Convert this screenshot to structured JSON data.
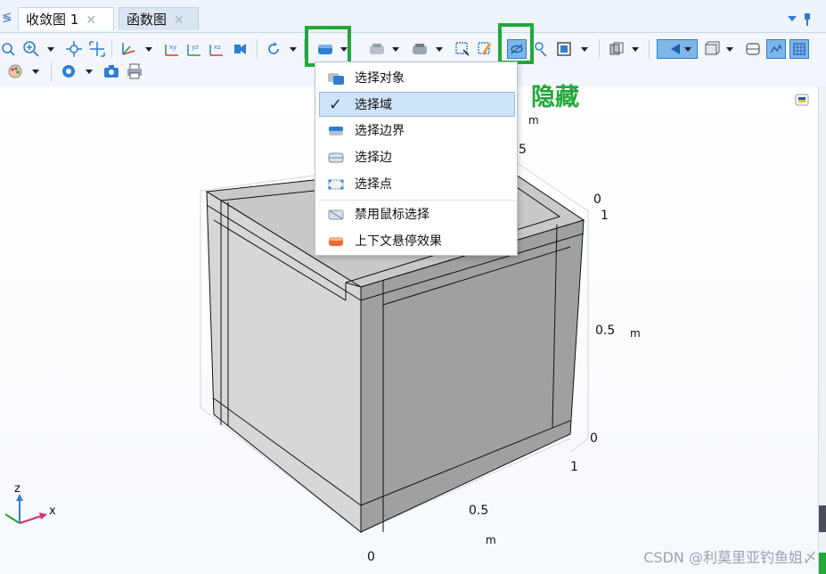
{
  "tabs": [
    {
      "label": "收敛图 1"
    },
    {
      "label": "函数图"
    }
  ],
  "selection_menu": {
    "items": [
      {
        "label": "选择对象",
        "checked": false,
        "icon": "select-object-icon"
      },
      {
        "label": "选择域",
        "checked": true,
        "icon": "checkmark-icon"
      },
      {
        "label": "选择边界",
        "checked": false,
        "icon": "select-boundary-icon"
      },
      {
        "label": "选择边",
        "checked": false,
        "icon": "select-edge-icon"
      },
      {
        "label": "选择点",
        "checked": false,
        "icon": "select-point-icon"
      }
    ],
    "items2": [
      {
        "label": "禁用鼠标选择",
        "icon": "disable-mouse-select-icon"
      },
      {
        "label": "上下文悬停效果",
        "icon": "context-hover-icon"
      }
    ]
  },
  "annotation": "隐藏",
  "axes": {
    "right_top_zero": "0",
    "right_top_one": "1",
    "right_mid": "0.5",
    "right_zero": "0",
    "right_unit": "m",
    "top_unit": "m",
    "top_value": "5",
    "front_one": "1",
    "front_mid": "0.5",
    "front_unit": "m",
    "front_zero": "0"
  },
  "triad": {
    "z": "z",
    "x": "x"
  },
  "watermark": "CSDN @利莫里亚钓鱼姐〆",
  "colors": {
    "highlight": "#21a83a",
    "accent": "#2e7fd1"
  }
}
